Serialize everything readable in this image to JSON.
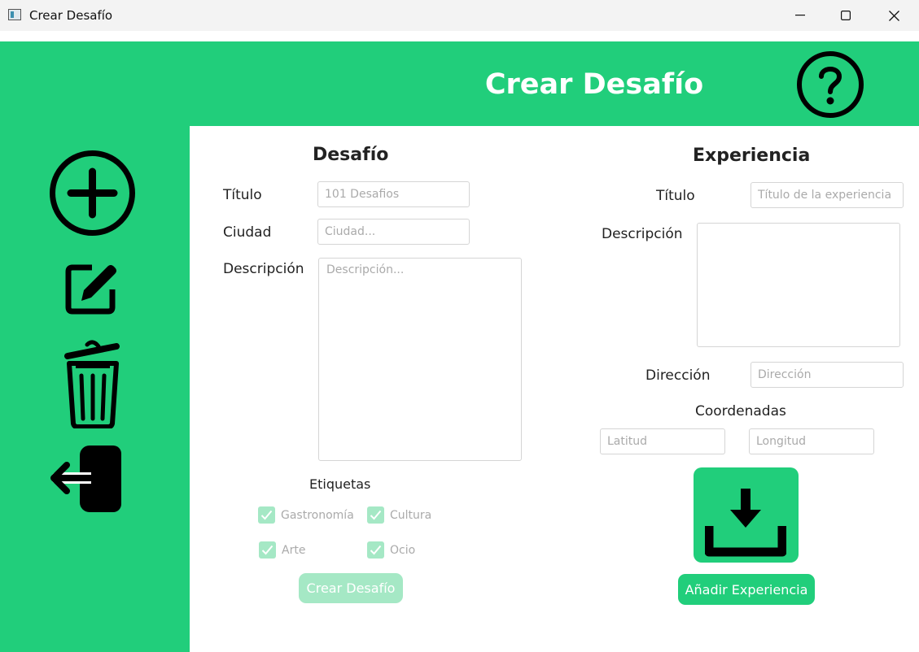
{
  "window": {
    "title": "Crear Desafío"
  },
  "header": {
    "title": "Crear Desafío"
  },
  "icons": {
    "help": "help-circle-icon",
    "add": "plus-circle-icon",
    "edit": "edit-square-icon",
    "delete": "trash-icon",
    "logout": "logout-icon",
    "download": "download-icon"
  },
  "colors": {
    "accent": "#21ce7b",
    "accent_light": "#a5e8c5",
    "titlebar": "#f3f3f3"
  },
  "desafio": {
    "heading": "Desafío",
    "titulo_label": "Título",
    "titulo_placeholder": "101 Desafios",
    "ciudad_label": "Ciudad",
    "ciudad_placeholder": "Ciudad...",
    "descripcion_label": "Descripción",
    "descripcion_placeholder": "Descripción...",
    "etiquetas_label": "Etiquetas",
    "tags": [
      {
        "label": "Gastronomía",
        "checked": true
      },
      {
        "label": "Cultura",
        "checked": true
      },
      {
        "label": "Arte",
        "checked": true
      },
      {
        "label": "Ocio",
        "checked": true
      }
    ],
    "submit_label": "Crear Desafío"
  },
  "experiencia": {
    "heading": "Experiencia",
    "titulo_label": "Título",
    "titulo_placeholder": "Título de la experiencia",
    "descripcion_label": "Descripción",
    "direccion_label": "Dirección",
    "direccion_placeholder": "Dirección",
    "coordenadas_label": "Coordenadas",
    "latitud_placeholder": "Latitud",
    "longitud_placeholder": "Longitud",
    "submit_label": "Añadir Experiencia"
  }
}
